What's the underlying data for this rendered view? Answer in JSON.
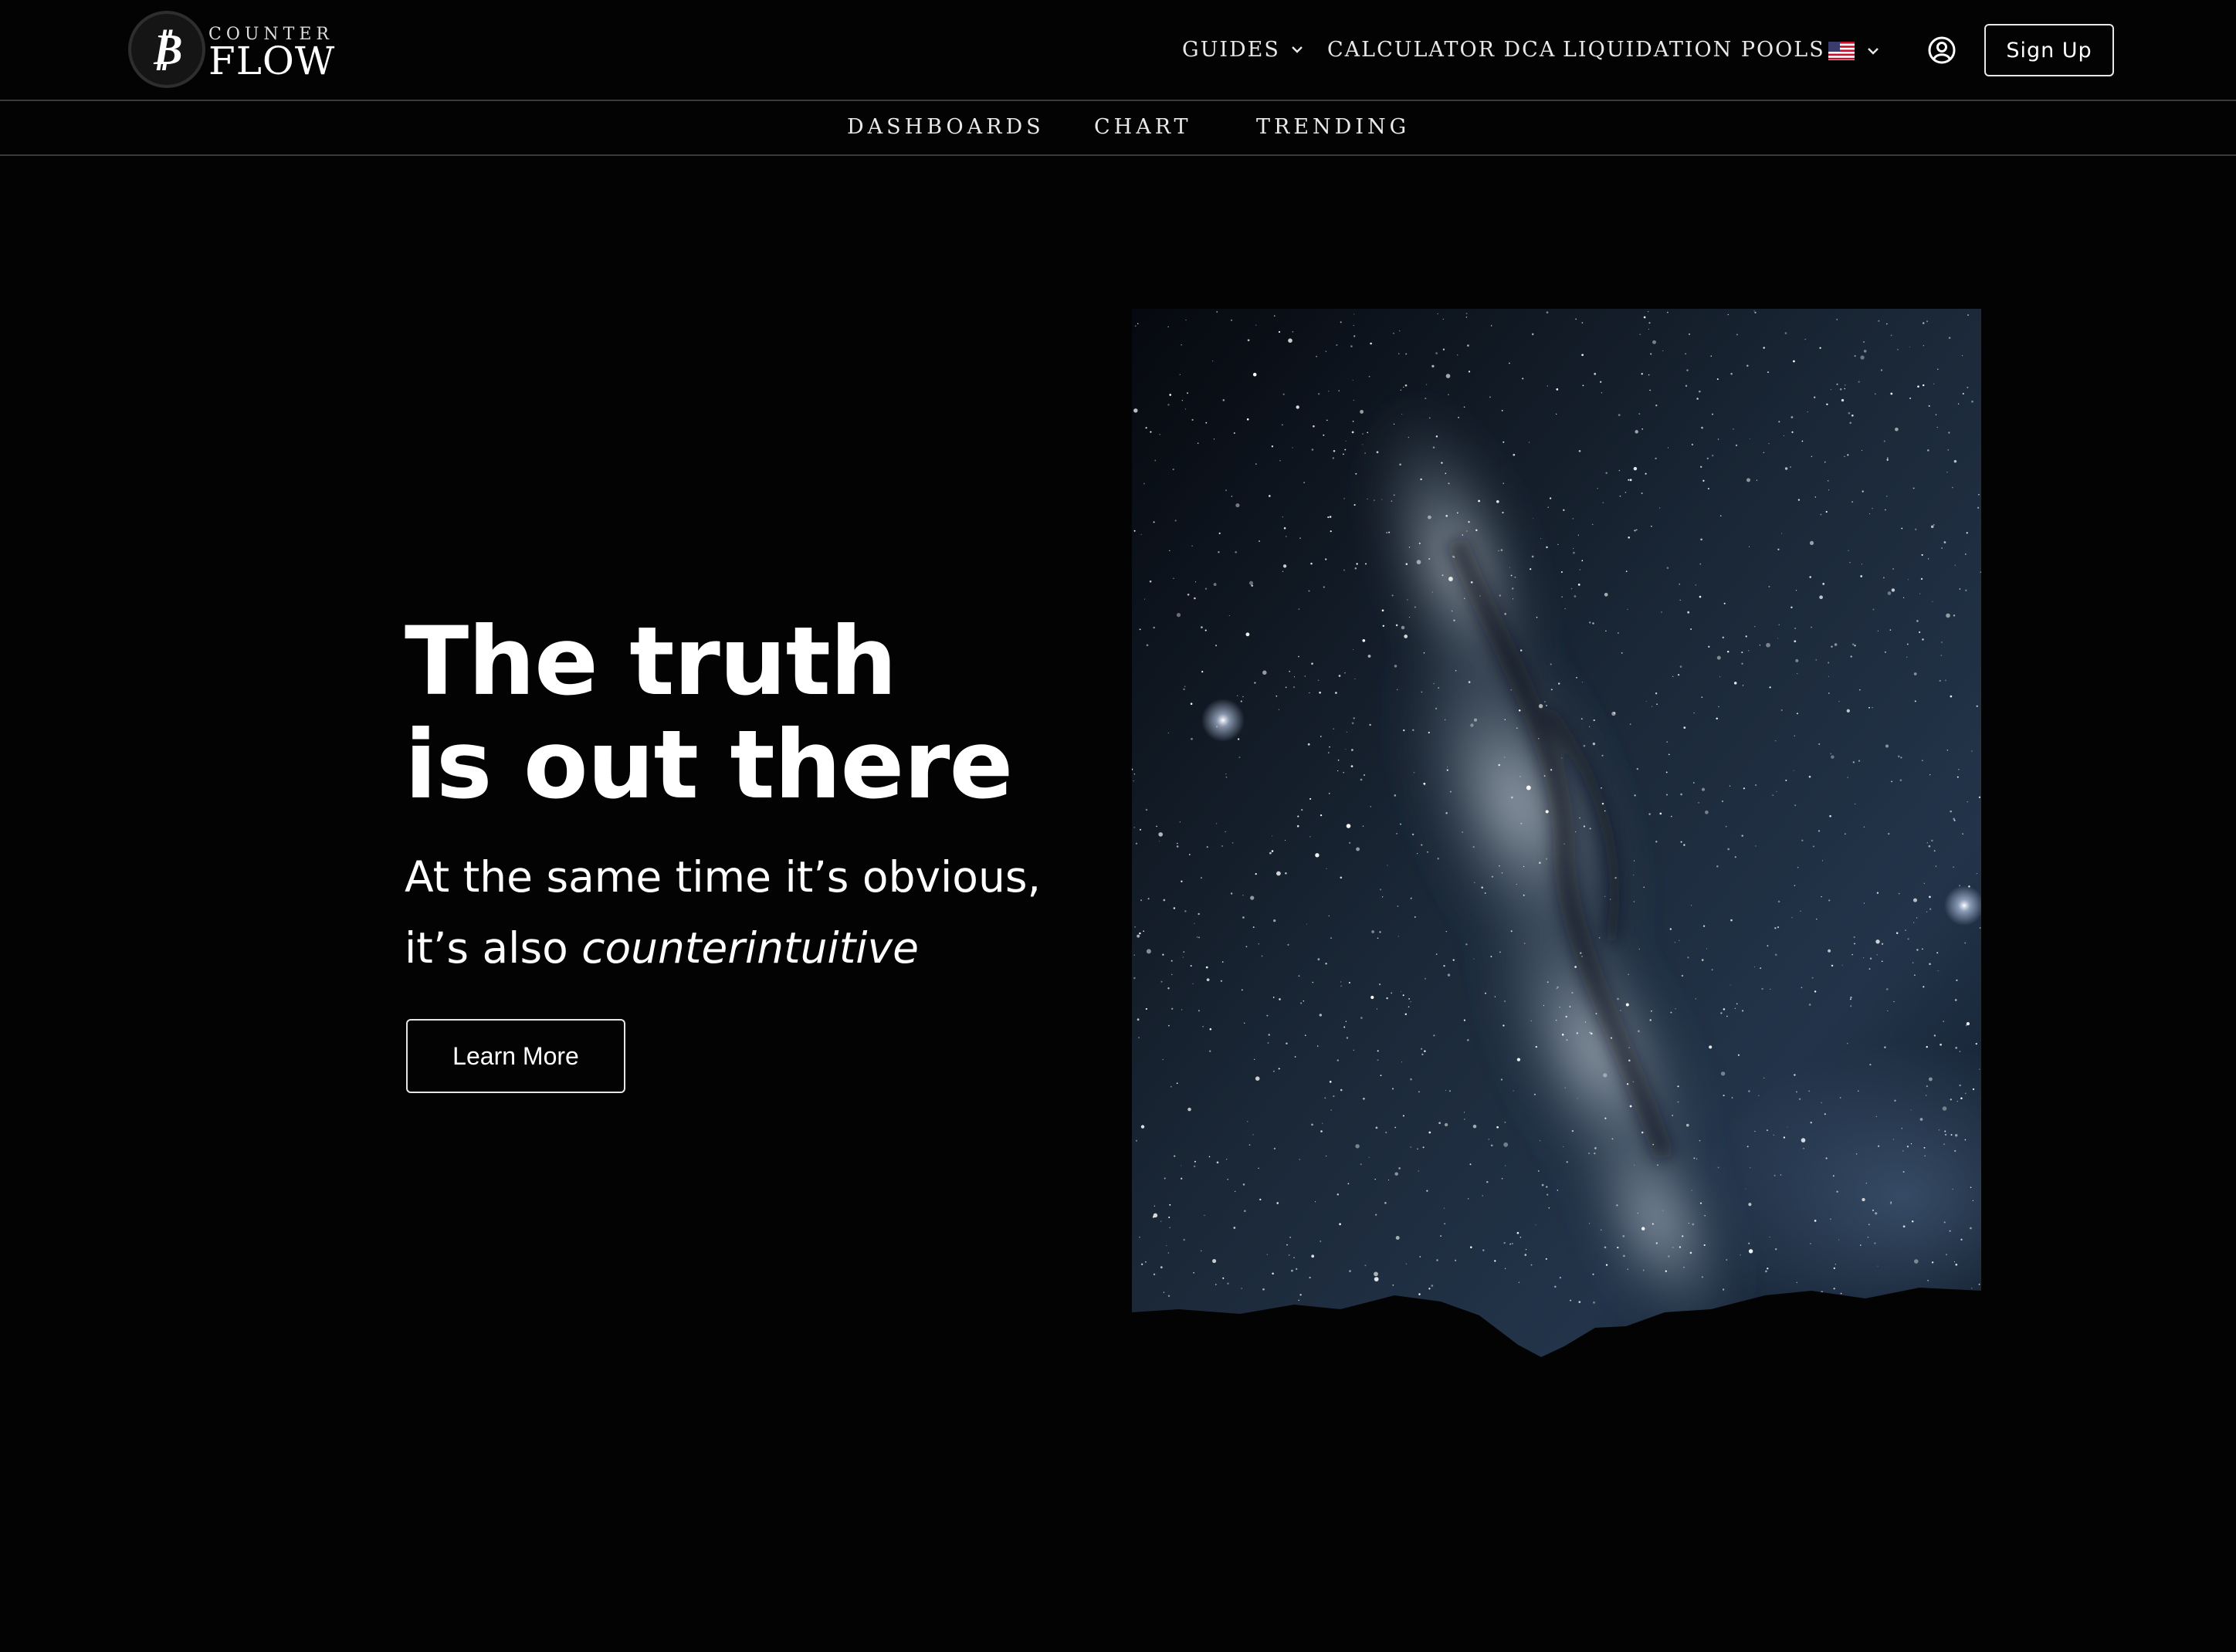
{
  "header": {
    "logo": {
      "small_text": "COUNTER",
      "big_text": "FLOW",
      "coin_symbol": "₿"
    },
    "nav": [
      {
        "label": "GUIDES",
        "has_dropdown": true
      },
      {
        "label": "CALCULATOR DCA",
        "has_dropdown": false
      },
      {
        "label": "LIQUIDATION POOLS",
        "has_dropdown": false
      }
    ],
    "language": {
      "flag": "us-flag-icon",
      "has_dropdown": true
    },
    "user_icon": "user-circle-icon",
    "signup_label": "Sign Up"
  },
  "subnav": [
    {
      "label": "DASHBOARDS"
    },
    {
      "label": "CHART"
    },
    {
      "label": "TRENDING"
    }
  ],
  "hero": {
    "title_line1": "The truth",
    "title_line2": "is out there",
    "subtitle_line1": "At the same time it’s obvious,",
    "subtitle_line2_prefix": "it’s also ",
    "subtitle_line2_emphasis": "counterintuitive",
    "cta_label": "Learn More"
  },
  "colors": {
    "background": "#030303",
    "text": "#ffffff",
    "divider": "#3a3a3a",
    "sky_dark": "#0b1420",
    "sky_light": "#3e4f63"
  }
}
